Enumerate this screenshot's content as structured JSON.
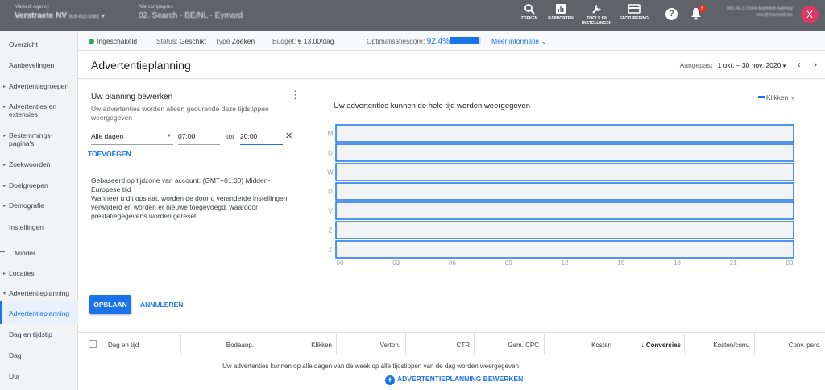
{
  "topbar": {
    "account_small": "Markedt Agency",
    "account_name": "Verstraete NV",
    "account_id": "616-812-1581",
    "campaign_small": "Alle campagnes",
    "campaign_name": "02. Search - BE/NL - Eymard",
    "tools": [
      {
        "label": "ZOEKEN",
        "icon": "search-icon"
      },
      {
        "label": "RAPPORTEN",
        "icon": "reports-icon"
      },
      {
        "label": "TOOLS EN INSTELLINGEN",
        "icon": "wrench-icon"
      },
      {
        "label": "FACTURERING",
        "icon": "credit-card-icon"
      }
    ],
    "help_label": "?",
    "bell_badge": "!",
    "right_line1": "861-413-1584 Markedt Agency",
    "right_line2": "seo@markedt.be",
    "avatar_letter": "X"
  },
  "sidebar": {
    "items": [
      {
        "label": "Overzicht",
        "arrow": false
      },
      {
        "label": "Aanbevelingen",
        "arrow": false
      },
      {
        "label": "Advertentiegroepen",
        "arrow": true
      },
      {
        "label": "Advertenties en extensies",
        "arrow": true
      },
      {
        "label": "Bestemmings-pagina's",
        "arrow": true
      },
      {
        "label": "Zoekwoorden",
        "arrow": true
      },
      {
        "label": "Doelgroepen",
        "arrow": true
      },
      {
        "label": "Demografie",
        "arrow": true
      },
      {
        "label": "Instellingen",
        "arrow": false
      },
      {
        "label": "Minder",
        "arrow": false
      },
      {
        "label": "Locaties",
        "arrow": true
      },
      {
        "label": "Advertentieplanning",
        "arrow": true
      },
      {
        "label": "Advertentieplanning",
        "arrow": false,
        "active": true
      },
      {
        "label": "Dag en tijdstip",
        "arrow": false
      },
      {
        "label": "Dag",
        "arrow": false
      },
      {
        "label": "Uur",
        "arrow": false
      }
    ]
  },
  "status": {
    "enabled": "Ingeschakeld",
    "status_label": "Status:",
    "status_value": "Geschikt",
    "type_label": "Type",
    "type_value": "Zoeken",
    "budget_label": "Budget:",
    "budget_value": "€ 13,00/dag",
    "opt_label": "Optimalisatiescore:",
    "opt_value": "92,4%",
    "opt_fraction": 0.924,
    "more_info": "Meer informatie"
  },
  "header": {
    "title": "Advertentieplanning",
    "date_label": "Aangepast",
    "date_range": "1 okt. – 30 nov. 2020"
  },
  "editor": {
    "title": "Uw planning bewerken",
    "description": "Uw advertenties worden alleen gedurende deze tijdstippen weergegeven",
    "day_value": "Alle dagen",
    "start_time": "07:00",
    "to_label": "tot",
    "end_time": "20:00",
    "remove_symbol": "✕",
    "add_link": "TOEVOEGEN",
    "note_line1": "Gebaseerd op tijdzone van account: (GMT+01:00) Midden-Europese tijd",
    "note_line2": "Wanneer u dit opslaat, worden de door u veranderde instellingen verwijderd en worden er nieuwe toegevoegd, waardoor prestatiegegevens worden gereset",
    "save": "OPSLAAN",
    "cancel": "ANNULEREN"
  },
  "chart_data": {
    "type": "heatmap",
    "title": "Uw advertenties kunnen de hele tijd worden weergegeven",
    "metric": "Klikken",
    "rows": [
      "M",
      "D",
      "W",
      "D",
      "V",
      "Z",
      "Z"
    ],
    "x_ticks": [
      "00",
      "03",
      "06",
      "09",
      "12",
      "15",
      "18",
      "21",
      "00"
    ],
    "row_color": "#f1f3f4",
    "border_color": "#1a73e8"
  },
  "table": {
    "headers": [
      "Dag en tijd",
      "Bodaanp.",
      "Klikken",
      "Verton.",
      "CTR",
      "Gem. CPC",
      "Kosten",
      "Conversies",
      "Kosten/conv.",
      "Conv. perc."
    ],
    "sort_arrow": "↓",
    "empty_message": "Uw advertenties kunnen op alle dagen van de week op alle tijdstippen van de dag worden weergegeven",
    "edit_link": "ADVERTENTIEPLANNING BEWERKEN"
  }
}
